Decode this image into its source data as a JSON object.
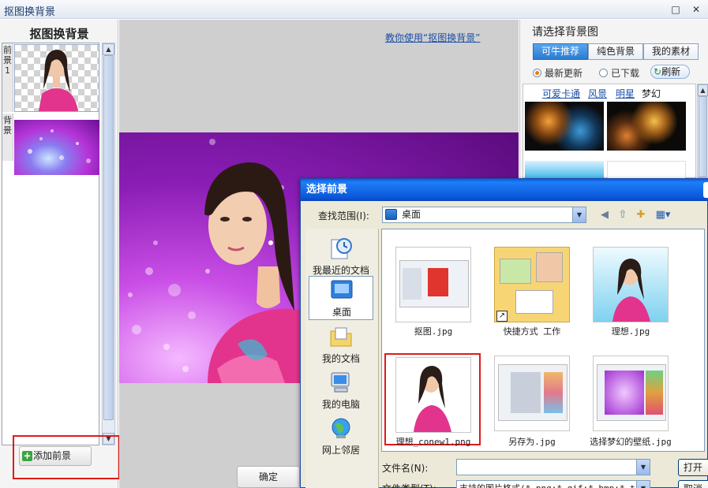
{
  "window": {
    "title": "抠图换背景",
    "restore_glyph": "□",
    "close_glyph": "✕"
  },
  "left_panel": {
    "title": "抠图换背景",
    "foreground_tab": "前景1",
    "background_tab": "背景",
    "add_foreground_button": "添加前景"
  },
  "center": {
    "tutorial_link": "教你使用“抠图换背景”",
    "ok_button": "确定"
  },
  "right_panel": {
    "title": "请选择背景图",
    "tabs": [
      "可牛推荐",
      "纯色背景",
      "我的素材"
    ],
    "radio_latest": "最新更新",
    "radio_downloaded": "已下载",
    "refresh": "刷新",
    "categories": [
      "可爱卡通",
      "风景",
      "明星",
      "梦幻"
    ]
  },
  "dialog": {
    "title": "选择前景",
    "look_in_label": "查找范围(I):",
    "look_in_value": "桌面",
    "places": [
      "我最近的文档",
      "桌面",
      "我的文档",
      "我的电脑",
      "网上邻居"
    ],
    "files": [
      "抠图.jpg",
      "快捷方式 工作",
      "理想.jpg",
      "理想_conew1.png",
      "另存为.jpg",
      "选择梦幻的壁纸.jpg"
    ],
    "file_name_label": "文件名(N):",
    "file_name_value": "",
    "file_type_label": "文件类型(T):",
    "file_type_value": "支持的图片格式(*.png;*.gif;*.bmp;*.ti",
    "open_button": "打开",
    "cancel_button": "取消"
  },
  "colors": {
    "highlight": "#e01a1a",
    "link": "#1b4fa8",
    "dialog_title": "#0a5ae0",
    "tab_selected": "#2f86d8"
  }
}
